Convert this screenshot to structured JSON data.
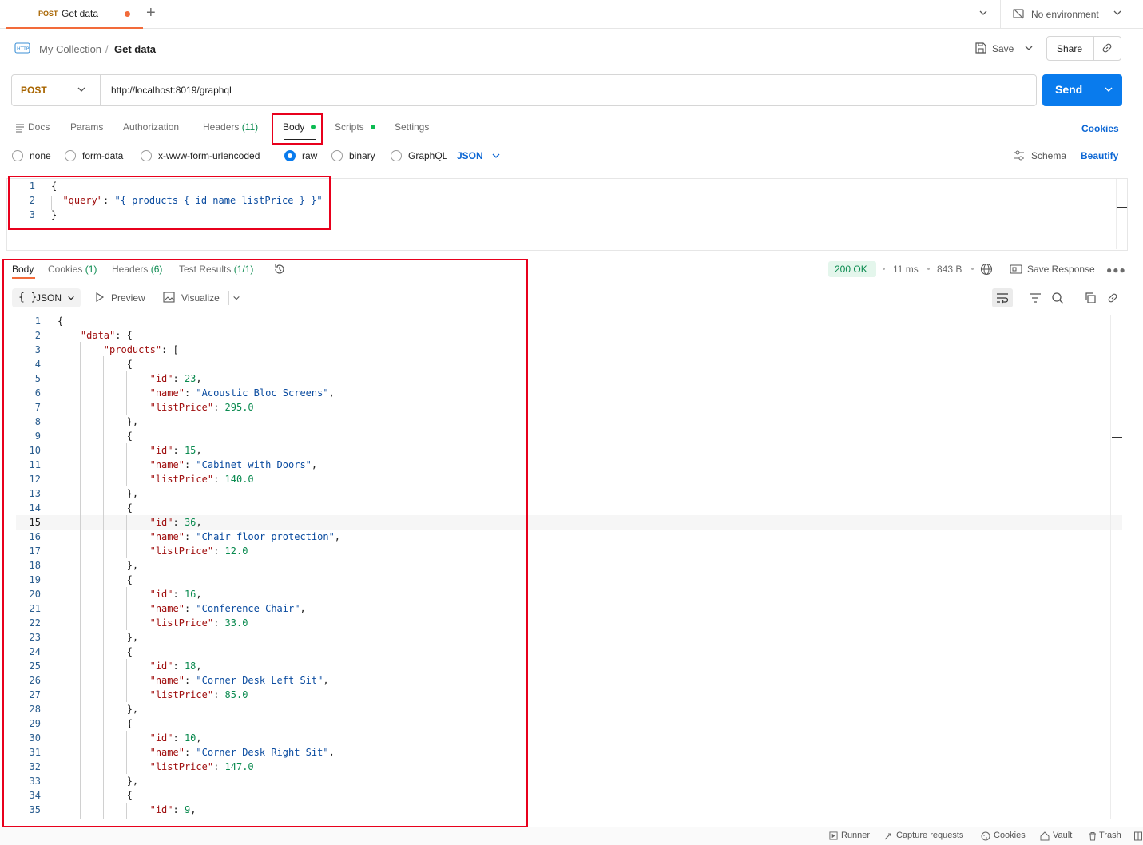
{
  "tab": {
    "method": "POST",
    "title": "Get data"
  },
  "environment": {
    "label": "No environment"
  },
  "breadcrumb": {
    "collection": "My Collection",
    "separator": "/",
    "request": "Get data"
  },
  "actions": {
    "save": "Save",
    "share": "Share"
  },
  "request": {
    "method": "POST",
    "url": "http://localhost:8019/graphql",
    "send": "Send"
  },
  "request_tabs": {
    "docs": "Docs",
    "params": "Params",
    "authorization": "Authorization",
    "headers": "Headers",
    "headers_count": "(11)",
    "body": "Body",
    "scripts": "Scripts",
    "settings": "Settings",
    "cookies": "Cookies"
  },
  "body_types": {
    "none": "none",
    "form_data": "form-data",
    "urlencoded": "x-www-form-urlencoded",
    "raw": "raw",
    "binary": "binary",
    "graphql": "GraphQL",
    "format": "JSON",
    "schema": "Schema",
    "beautify": "Beautify"
  },
  "request_body_lines": [
    {
      "n": "1",
      "parts": [
        [
          "p",
          "{"
        ]
      ]
    },
    {
      "n": "2",
      "parts": [
        [
          "p",
          "  "
        ],
        [
          "k",
          "\"query\""
        ],
        [
          "p",
          ": "
        ],
        [
          "s",
          "\"{ products { id name listPrice } }\""
        ]
      ]
    },
    {
      "n": "3",
      "parts": [
        [
          "p",
          "}"
        ]
      ]
    }
  ],
  "response_tabs": {
    "body": "Body",
    "cookies": "Cookies",
    "cookies_count": "(1)",
    "headers": "Headers",
    "headers_count": "(6)",
    "tests": "Test Results",
    "tests_count": "(1/1)"
  },
  "response_meta": {
    "status": "200 OK",
    "time": "11 ms",
    "size": "843 B",
    "save_response": "Save Response"
  },
  "response_toolbar": {
    "format": "JSON",
    "preview": "Preview",
    "visualize": "Visualize"
  },
  "response_body_lines": [
    {
      "n": "1",
      "parts": [
        [
          "p",
          "{"
        ]
      ]
    },
    {
      "n": "2",
      "parts": [
        [
          "p",
          "    "
        ],
        [
          "k",
          "\"data\""
        ],
        [
          "p",
          ": {"
        ]
      ]
    },
    {
      "n": "3",
      "parts": [
        [
          "p",
          "        "
        ],
        [
          "k",
          "\"products\""
        ],
        [
          "p",
          ": ["
        ]
      ]
    },
    {
      "n": "4",
      "parts": [
        [
          "p",
          "            {"
        ]
      ]
    },
    {
      "n": "5",
      "parts": [
        [
          "p",
          "                "
        ],
        [
          "k",
          "\"id\""
        ],
        [
          "p",
          ": "
        ],
        [
          "n",
          "23"
        ],
        [
          "p",
          ","
        ]
      ]
    },
    {
      "n": "6",
      "parts": [
        [
          "p",
          "                "
        ],
        [
          "k",
          "\"name\""
        ],
        [
          "p",
          ": "
        ],
        [
          "s",
          "\"Acoustic Bloc Screens\""
        ],
        [
          "p",
          ","
        ]
      ]
    },
    {
      "n": "7",
      "parts": [
        [
          "p",
          "                "
        ],
        [
          "k",
          "\"listPrice\""
        ],
        [
          "p",
          ": "
        ],
        [
          "n",
          "295.0"
        ]
      ]
    },
    {
      "n": "8",
      "parts": [
        [
          "p",
          "            },"
        ]
      ]
    },
    {
      "n": "9",
      "parts": [
        [
          "p",
          "            {"
        ]
      ]
    },
    {
      "n": "10",
      "parts": [
        [
          "p",
          "                "
        ],
        [
          "k",
          "\"id\""
        ],
        [
          "p",
          ": "
        ],
        [
          "n",
          "15"
        ],
        [
          "p",
          ","
        ]
      ]
    },
    {
      "n": "11",
      "parts": [
        [
          "p",
          "                "
        ],
        [
          "k",
          "\"name\""
        ],
        [
          "p",
          ": "
        ],
        [
          "s",
          "\"Cabinet with Doors\""
        ],
        [
          "p",
          ","
        ]
      ]
    },
    {
      "n": "12",
      "parts": [
        [
          "p",
          "                "
        ],
        [
          "k",
          "\"listPrice\""
        ],
        [
          "p",
          ": "
        ],
        [
          "n",
          "140.0"
        ]
      ]
    },
    {
      "n": "13",
      "parts": [
        [
          "p",
          "            },"
        ]
      ]
    },
    {
      "n": "14",
      "parts": [
        [
          "p",
          "            {"
        ]
      ]
    },
    {
      "n": "15",
      "parts": [
        [
          "p",
          "                "
        ],
        [
          "k",
          "\"id\""
        ],
        [
          "p",
          ": "
        ],
        [
          "n",
          "36"
        ],
        [
          "p",
          ","
        ]
      ]
    },
    {
      "n": "16",
      "parts": [
        [
          "p",
          "                "
        ],
        [
          "k",
          "\"name\""
        ],
        [
          "p",
          ": "
        ],
        [
          "s",
          "\"Chair floor protection\""
        ],
        [
          "p",
          ","
        ]
      ]
    },
    {
      "n": "17",
      "parts": [
        [
          "p",
          "                "
        ],
        [
          "k",
          "\"listPrice\""
        ],
        [
          "p",
          ": "
        ],
        [
          "n",
          "12.0"
        ]
      ]
    },
    {
      "n": "18",
      "parts": [
        [
          "p",
          "            },"
        ]
      ]
    },
    {
      "n": "19",
      "parts": [
        [
          "p",
          "            {"
        ]
      ]
    },
    {
      "n": "20",
      "parts": [
        [
          "p",
          "                "
        ],
        [
          "k",
          "\"id\""
        ],
        [
          "p",
          ": "
        ],
        [
          "n",
          "16"
        ],
        [
          "p",
          ","
        ]
      ]
    },
    {
      "n": "21",
      "parts": [
        [
          "p",
          "                "
        ],
        [
          "k",
          "\"name\""
        ],
        [
          "p",
          ": "
        ],
        [
          "s",
          "\"Conference Chair\""
        ],
        [
          "p",
          ","
        ]
      ]
    },
    {
      "n": "22",
      "parts": [
        [
          "p",
          "                "
        ],
        [
          "k",
          "\"listPrice\""
        ],
        [
          "p",
          ": "
        ],
        [
          "n",
          "33.0"
        ]
      ]
    },
    {
      "n": "23",
      "parts": [
        [
          "p",
          "            },"
        ]
      ]
    },
    {
      "n": "24",
      "parts": [
        [
          "p",
          "            {"
        ]
      ]
    },
    {
      "n": "25",
      "parts": [
        [
          "p",
          "                "
        ],
        [
          "k",
          "\"id\""
        ],
        [
          "p",
          ": "
        ],
        [
          "n",
          "18"
        ],
        [
          "p",
          ","
        ]
      ]
    },
    {
      "n": "26",
      "parts": [
        [
          "p",
          "                "
        ],
        [
          "k",
          "\"name\""
        ],
        [
          "p",
          ": "
        ],
        [
          "s",
          "\"Corner Desk Left Sit\""
        ],
        [
          "p",
          ","
        ]
      ]
    },
    {
      "n": "27",
      "parts": [
        [
          "p",
          "                "
        ],
        [
          "k",
          "\"listPrice\""
        ],
        [
          "p",
          ": "
        ],
        [
          "n",
          "85.0"
        ]
      ]
    },
    {
      "n": "28",
      "parts": [
        [
          "p",
          "            },"
        ]
      ]
    },
    {
      "n": "29",
      "parts": [
        [
          "p",
          "            {"
        ]
      ]
    },
    {
      "n": "30",
      "parts": [
        [
          "p",
          "                "
        ],
        [
          "k",
          "\"id\""
        ],
        [
          "p",
          ": "
        ],
        [
          "n",
          "10"
        ],
        [
          "p",
          ","
        ]
      ]
    },
    {
      "n": "31",
      "parts": [
        [
          "p",
          "                "
        ],
        [
          "k",
          "\"name\""
        ],
        [
          "p",
          ": "
        ],
        [
          "s",
          "\"Corner Desk Right Sit\""
        ],
        [
          "p",
          ","
        ]
      ]
    },
    {
      "n": "32",
      "parts": [
        [
          "p",
          "                "
        ],
        [
          "k",
          "\"listPrice\""
        ],
        [
          "p",
          ": "
        ],
        [
          "n",
          "147.0"
        ]
      ]
    },
    {
      "n": "33",
      "parts": [
        [
          "p",
          "            },"
        ]
      ]
    },
    {
      "n": "34",
      "parts": [
        [
          "p",
          "            {"
        ]
      ]
    },
    {
      "n": "35",
      "parts": [
        [
          "p",
          "                "
        ],
        [
          "k",
          "\"id\""
        ],
        [
          "p",
          ": "
        ],
        [
          "n",
          "9"
        ],
        [
          "p",
          ","
        ]
      ]
    }
  ],
  "footer": {
    "runner": "Runner",
    "capture": "Capture requests",
    "cookies": "Cookies",
    "vault": "Vault",
    "trash": "Trash"
  }
}
